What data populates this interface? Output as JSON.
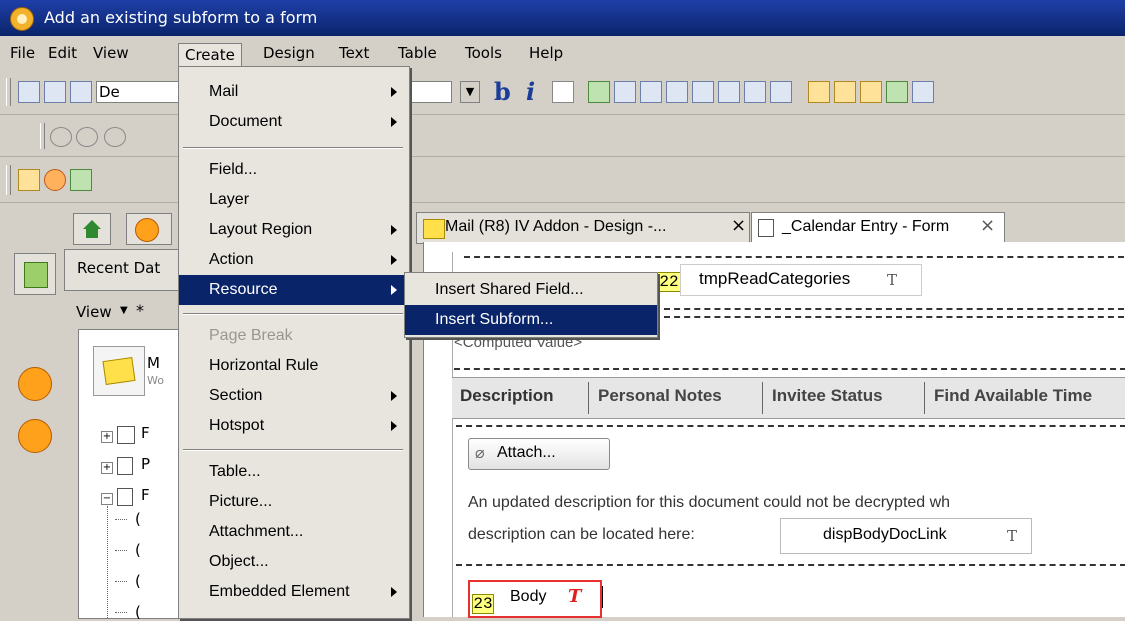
{
  "window": {
    "title": "Add an existing subform to a form"
  },
  "menubar": {
    "items": [
      "File",
      "Edit",
      "View",
      "Create",
      "Design",
      "Text",
      "Table",
      "Tools",
      "Help"
    ]
  },
  "toolbar": {
    "font_name": "De"
  },
  "tabs": {
    "mail_design": "Mail (R8) IV Addon - Design -...",
    "calendar_form": "_Calendar Entry - Form"
  },
  "left_panel": {
    "recent": "Recent Dat",
    "view": "View",
    "db_title": "M",
    "db_sub": "Wo",
    "tree": [
      {
        "label": "F"
      },
      {
        "label": "P"
      },
      {
        "label": "F"
      },
      {
        "label": "("
      },
      {
        "label": "("
      },
      {
        "label": "("
      },
      {
        "label": "("
      }
    ]
  },
  "create_menu": {
    "items": [
      {
        "label": "Mail",
        "submenu": true
      },
      {
        "label": "Document",
        "submenu": true
      },
      {
        "label": "Field..."
      },
      {
        "label": "Layer"
      },
      {
        "label": "Layout Region",
        "submenu": true
      },
      {
        "label": "Action",
        "submenu": true
      },
      {
        "label": "Resource",
        "submenu": true
      },
      {
        "label": "Page Break",
        "disabled": true
      },
      {
        "label": "Horizontal Rule"
      },
      {
        "label": "Section",
        "submenu": true
      },
      {
        "label": "Hotspot",
        "submenu": true
      },
      {
        "label": "Table..."
      },
      {
        "label": "Picture..."
      },
      {
        "label": "Attachment..."
      },
      {
        "label": "Object..."
      },
      {
        "label": "Embedded Element",
        "submenu": true
      }
    ]
  },
  "resource_menu": {
    "items": [
      "Insert Shared Field...",
      "Insert Subform..."
    ]
  },
  "form": {
    "field22_num": "22",
    "field22_name": "tmpReadCategories",
    "computed": "<Computed Value>",
    "tabs": [
      "Description",
      "Personal Notes",
      "Invitee Status",
      "Find Available Time"
    ],
    "attach_button": "Attach...",
    "notice_line1": "An updated description for this document could not be decrypted wh",
    "notice_line2": "description can be located here:",
    "link_field": "dispBodyDocLink",
    "field23_num": "23",
    "field23_name": "Body"
  },
  "colors": {
    "titlebar": "#0a246a",
    "highlight": "#0a246a",
    "number_tag": "#ffff80"
  }
}
